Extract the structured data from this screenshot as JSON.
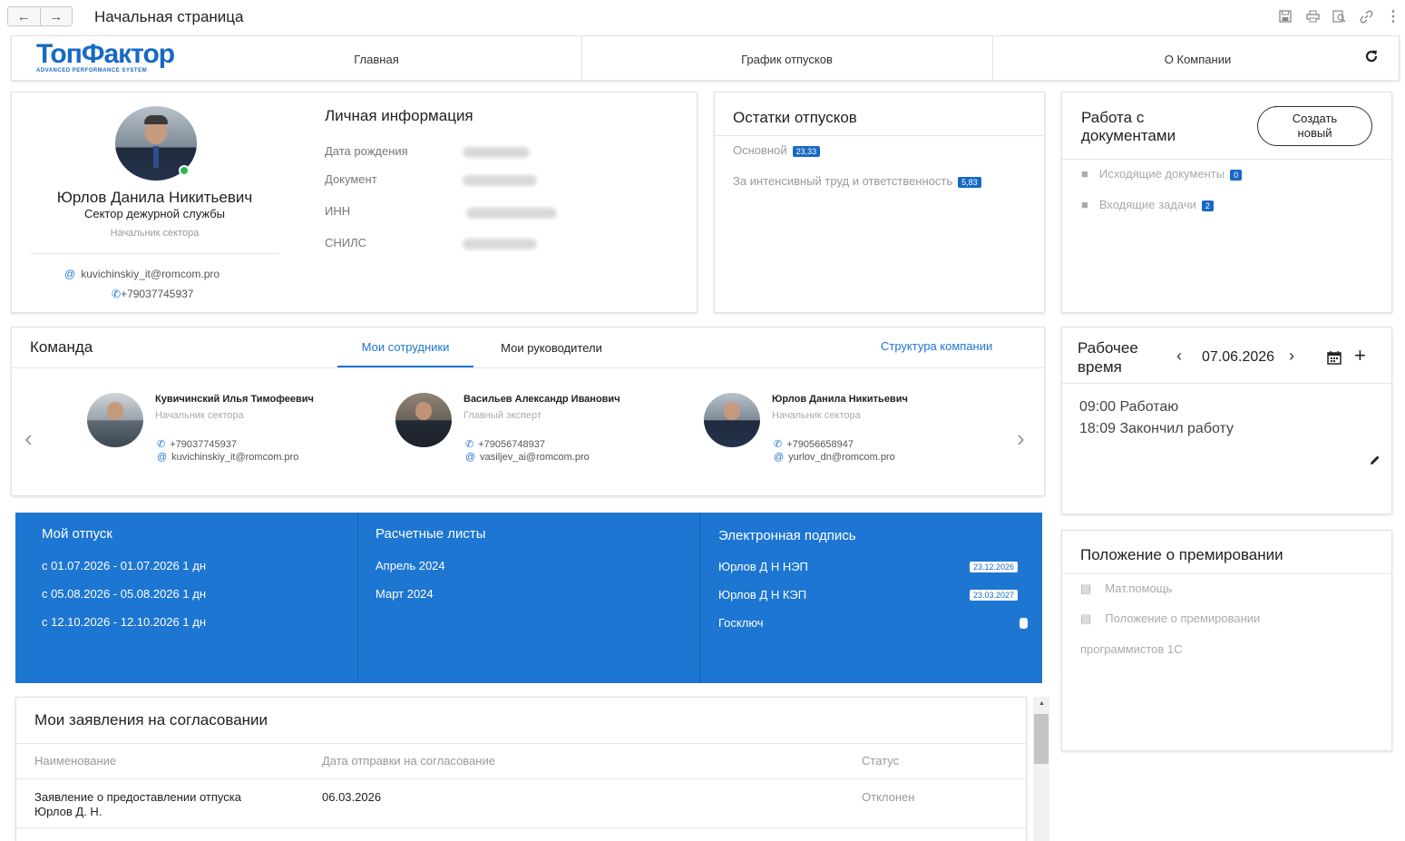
{
  "window": {
    "title": "Начальная страница"
  },
  "nav": {
    "logo_main": "ТопФактор",
    "logo_sub": "ADVANCED PERFORMANCE SYSTEM",
    "items": [
      "Главная",
      "График отпусков",
      "О Компании"
    ]
  },
  "profile": {
    "name": "Юрлов Данила Никитьевич",
    "department": "Сектор дежурной службы",
    "position": "Начальник сектора",
    "email": "kuvichinskiy_it@romcom.pro",
    "phone": "+79037745937"
  },
  "personal": {
    "title": "Личная информация",
    "fields": [
      "Дата рождения",
      "Документ",
      "ИНН",
      "СНИЛС"
    ]
  },
  "vacation_balance": {
    "title": "Остатки отпусков",
    "items": [
      {
        "label": "Основной",
        "value": "23,33"
      },
      {
        "label": "За интенсивный труд и ответственность",
        "value": "5,83"
      }
    ]
  },
  "documents": {
    "title": "Работа с документами",
    "create_button": "Создать новый",
    "items": [
      {
        "label": "Исходящие документы",
        "count": "0"
      },
      {
        "label": "Входящие задачи",
        "count": "2"
      }
    ]
  },
  "team": {
    "title": "Команда",
    "tabs": [
      "Мои сотрудники",
      "Мои руководители"
    ],
    "structure_link": "Структура компании",
    "members": [
      {
        "name": "Кувичинский Илья Тимофеевич",
        "position": "Начальник сектора",
        "phone": "+79037745937",
        "email": "kuvichinskiy_it@romcom.pro"
      },
      {
        "name": "Васильев Александр Иванович",
        "position": "Главный эксперт",
        "phone": "+79056748937",
        "email": "vasiljev_ai@romcom.pro"
      },
      {
        "name": "Юрлов Данила Никитьевич",
        "position": "Начальник сектора",
        "phone": "+79056658947",
        "email": "yurlov_dn@romcom.pro"
      }
    ]
  },
  "worktime": {
    "title": "Рабочее время",
    "date": "07.06.2026",
    "entries": [
      "09:00 Работаю",
      "18:09 Закончил работу"
    ]
  },
  "my_vacation": {
    "title": "Мой отпуск",
    "items": [
      "с 01.07.2026 - 01.07.2026 1 дн",
      "с 05.08.2026 - 05.08.2026 1 дн",
      "с 12.10.2026 - 12.10.2026 1 дн"
    ]
  },
  "payslips": {
    "title": "Расчетные листы",
    "items": [
      "Апрель 2024",
      "Март 2024"
    ]
  },
  "esign": {
    "title": "Электронная подпись",
    "items": [
      {
        "label": "Юрлов Д Н НЭП",
        "date": "23.12.2026"
      },
      {
        "label": "Юрлов Д Н КЭП",
        "date": "23.03.2027"
      },
      {
        "label": "Госключ",
        "date": ""
      }
    ]
  },
  "bonus": {
    "title": "Положение о премировании",
    "items": [
      "Мат.помощь",
      "Положение о премировании"
    ],
    "extra": "программистов 1С"
  },
  "applications": {
    "title": "Мои заявления на согласовании",
    "columns": [
      "Наименование",
      "Дата отправки на согласование",
      "Статус"
    ],
    "rows": [
      {
        "name_line1": "Заявление о предоставлении отпуска",
        "name_line2": "Юрлов Д. Н.",
        "date": "06.03.2026",
        "status": "Отклонен"
      }
    ]
  },
  "colors": {
    "accent": "#1d76d2",
    "brand": "#1769c4"
  }
}
